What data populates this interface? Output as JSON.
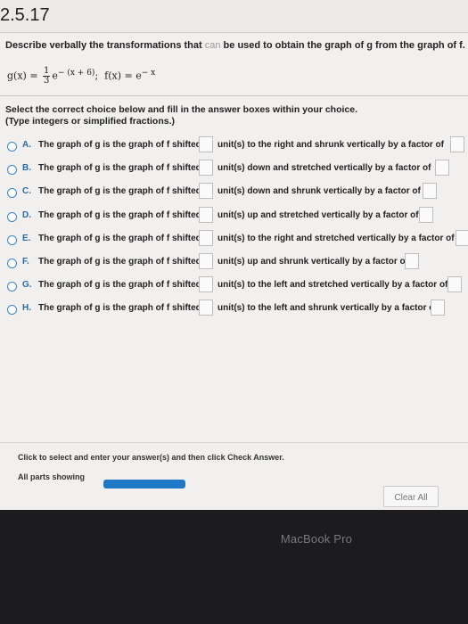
{
  "header": {
    "problem_number": "2.5.17"
  },
  "question": {
    "prefix": "Describe verbally the transformations that",
    "faded": " can ",
    "suffix": "be used to obtain the graph of g from the graph of f."
  },
  "formula": {
    "g_left": "g(x) =",
    "frac_num": "1",
    "frac_den": "3",
    "g_base": "e",
    "g_exp": "− (x + 6)",
    "sep": ";",
    "f_left": "f(x) =",
    "f_base": "e",
    "f_exp": "− x"
  },
  "instructions": {
    "line1": "Select the correct choice below and fill in the answer boxes within your choice.",
    "line2": "(Type integers or simplified fractions.)"
  },
  "choices": [
    {
      "letter": "A.",
      "text1": "The graph of g is the graph of f shifted",
      "text2": "unit(s) to the right and shrunk vertically by a factor of"
    },
    {
      "letter": "B.",
      "text1": "The graph of g is the graph of f shifted",
      "text2": "unit(s) down and stretched vertically by a factor of"
    },
    {
      "letter": "C.",
      "text1": "The graph of g is the graph of f shifted",
      "text2": "unit(s) down and shrunk vertically by a factor of"
    },
    {
      "letter": "D.",
      "text1": "The graph of g is the graph of f shifted",
      "text2": "unit(s) up and stretched vertically by a factor of"
    },
    {
      "letter": "E.",
      "text1": "The graph of g is the graph of f shifted",
      "text2": "unit(s) to the right and stretched vertically by a factor of"
    },
    {
      "letter": "F.",
      "text1": "The graph of g is the graph of f shifted",
      "text2": "unit(s) up and shrunk vertically by a factor of"
    },
    {
      "letter": "G.",
      "text1": "The graph of g is the graph of f shifted",
      "text2": "unit(s) to the left and stretched vertically by a factor of"
    },
    {
      "letter": "H.",
      "text1": "The graph of g is the graph of f shifted",
      "text2": "unit(s) to the left and shrunk vertically by a factor of"
    }
  ],
  "footer": {
    "hint": "Click to select and enter your answer(s) and then click Check Answer.",
    "parts_label": "All parts showing",
    "progress_fraction": 1.0,
    "clear_all_label": "Clear All"
  },
  "bezel": {
    "brand": "MacBook Pro"
  },
  "colors": {
    "accent": "#1f78c5",
    "radio_border": "#3a86c8",
    "screen_bg": "#f1f0ee",
    "bezel_bg": "#1c1c1e"
  }
}
